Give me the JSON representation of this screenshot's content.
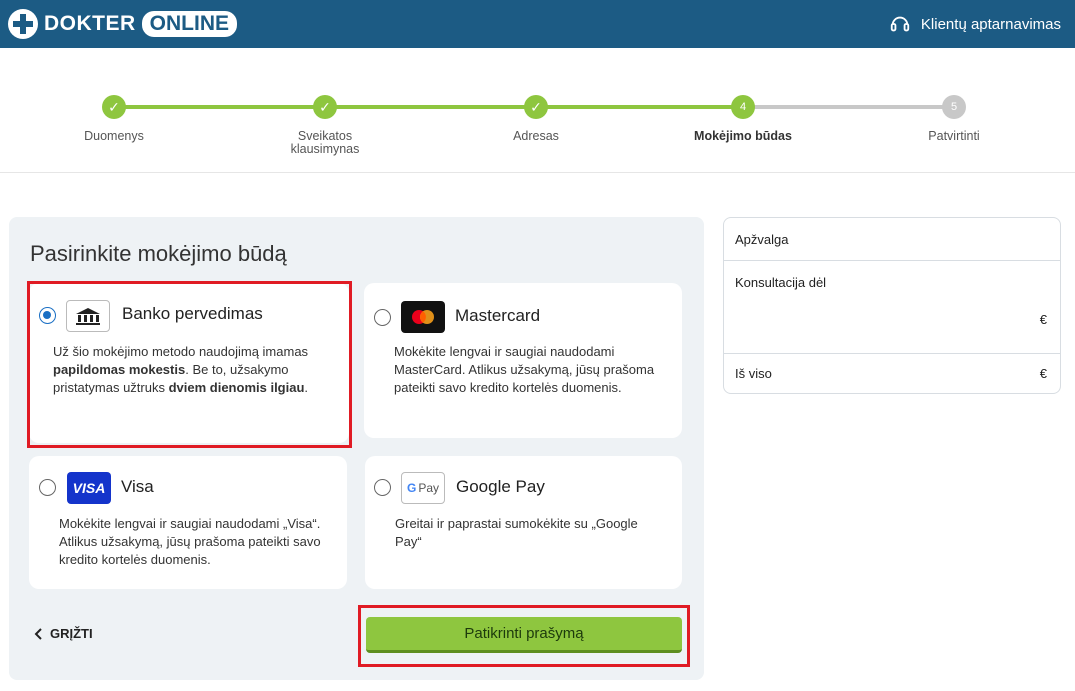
{
  "header": {
    "logo_part1": "DOKTER",
    "logo_part2": "ONLINE",
    "support_label": "Klientų aptarnavimas",
    "support_icon": "headset-icon"
  },
  "colors": {
    "header_bg": "#1c5b84",
    "step_done": "#8ec63f",
    "step_pending": "#c8c8c8",
    "cta_bg": "#8ec63f",
    "highlight": "#e01b24",
    "radio_selected": "#1a6fc4"
  },
  "stepper": {
    "steps": [
      {
        "label": "Duomenys",
        "marker": "✓",
        "state": "done"
      },
      {
        "label": "Sveikatos\nklausimynas",
        "marker": "✓",
        "state": "done"
      },
      {
        "label": "Adresas",
        "marker": "✓",
        "state": "done"
      },
      {
        "label": "Mokėjimo būdas",
        "marker": "4",
        "state": "active"
      },
      {
        "label": "Patvirtinti",
        "marker": "5",
        "state": "pending"
      }
    ]
  },
  "payment": {
    "title": "Pasirinkite mokėjimo būdą",
    "methods": [
      {
        "id": "bank",
        "name": "Banko pervedimas",
        "icon": "bank-icon",
        "selected": true,
        "desc_parts": [
          "Už šio mokėjimo metodo naudojimą imamas ",
          "papildomas mokestis",
          ". Be to, užsakymo pristatymas užtruks ",
          "dviem dienomis ilgiau",
          "."
        ]
      },
      {
        "id": "mastercard",
        "name": "Mastercard",
        "icon": "mastercard-icon",
        "selected": false,
        "desc": "Mokėkite lengvai ir saugiai naudodami MasterCard. Atlikus užsakymą, jūsų prašoma pateikti savo kredito kortelės duomenis."
      },
      {
        "id": "visa",
        "name": "Visa",
        "icon": "visa-icon",
        "icon_text": "VISA",
        "selected": false,
        "desc": "Mokėkite lengvai ir saugiai naudodami „Visa“. Atlikus užsakymą, jūsų prašoma pateikti savo kredito kortelės duomenis."
      },
      {
        "id": "googlepay",
        "name": "Google Pay",
        "icon": "google-pay-icon",
        "icon_text_g": "G",
        "icon_text_pay": "Pay",
        "selected": false,
        "desc": "Greitai ir paprastai sumokėkite su „Google Pay“"
      }
    ],
    "back_label": "GRĮŽTI",
    "submit_label": "Patikrinti prašymą"
  },
  "summary": {
    "title": "Apžvalga",
    "consult_label": "Konsultacija dėl",
    "consult_value": "€",
    "total_label": "Iš viso",
    "total_value": "€"
  }
}
